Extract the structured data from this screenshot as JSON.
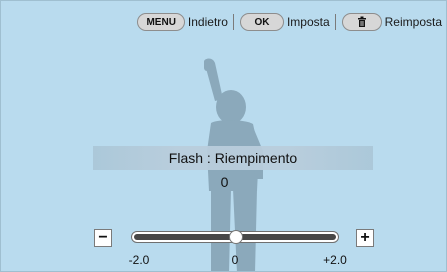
{
  "topbar": {
    "back": {
      "button": "MENU",
      "label": "Indietro"
    },
    "set": {
      "button": "OK",
      "label": "Imposta"
    },
    "reset": {
      "label": "Reimposta"
    }
  },
  "setting": {
    "title": "Flash : Riempimento",
    "value": "0"
  },
  "slider": {
    "min_label": "-2.0",
    "mid_label": "0",
    "max_label": "+2.0",
    "current": 0,
    "min": -2.0,
    "max": 2.0,
    "minus_symbol": "−",
    "plus_symbol": "+"
  },
  "colors": {
    "background": "#b9dbee",
    "silhouette": "#8ba9bb",
    "track": "#474747"
  }
}
